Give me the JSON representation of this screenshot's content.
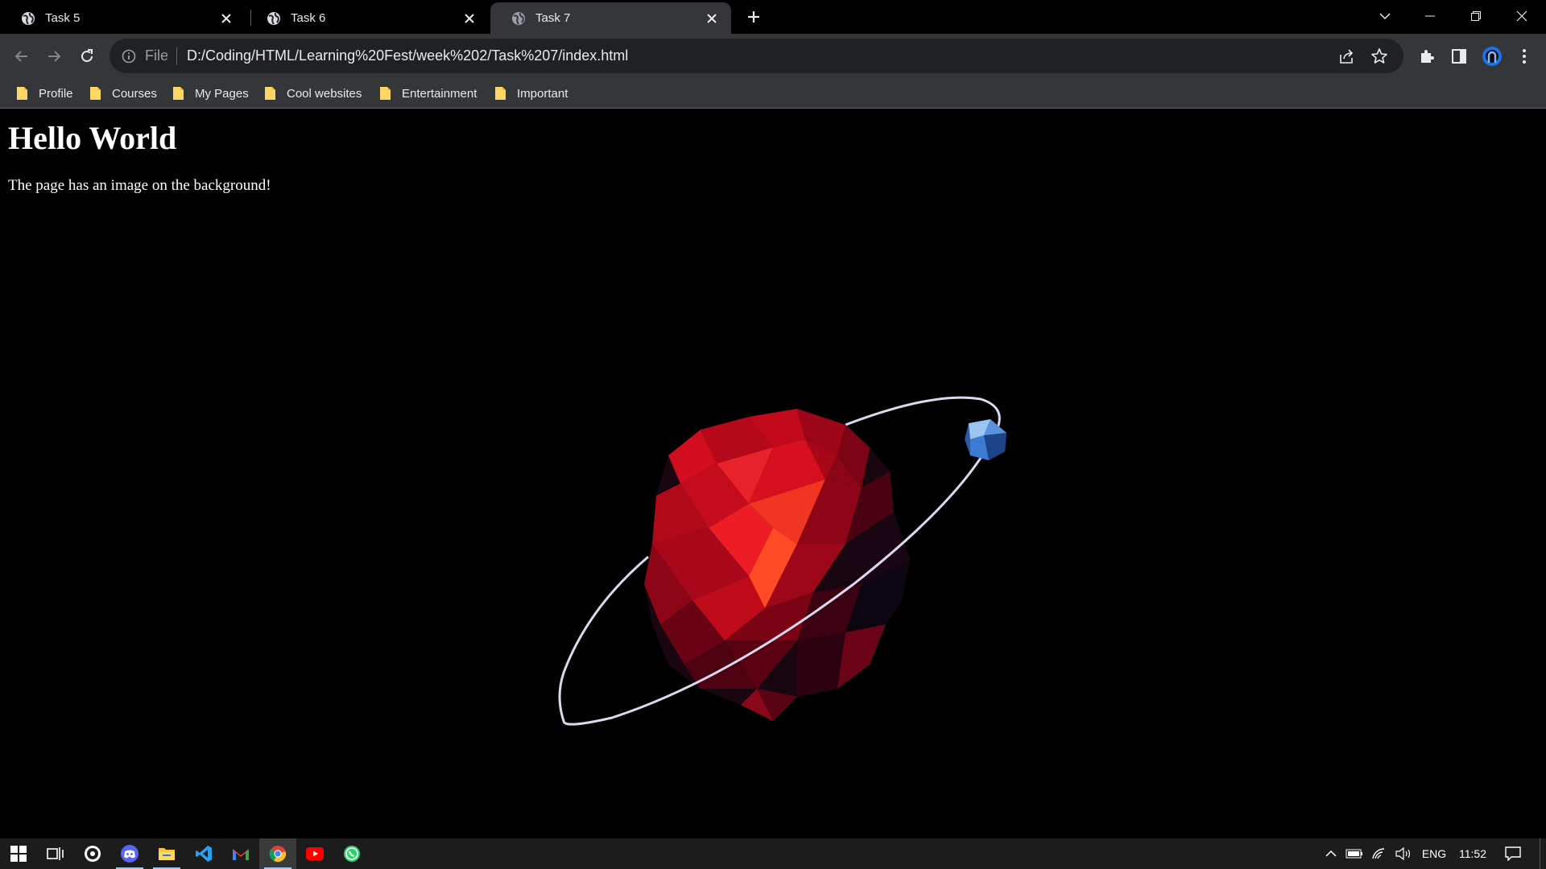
{
  "browser": {
    "tabs": [
      {
        "title": "Task 5",
        "active": false
      },
      {
        "title": "Task 6",
        "active": false
      },
      {
        "title": "Task 7",
        "active": true
      }
    ],
    "address": {
      "scheme_label": "File",
      "url": "D:/Coding/HTML/Learning%20Fest/week%202/Task%207/index.html"
    },
    "bookmarks": [
      "Profile",
      "Courses",
      "My Pages",
      "Cool websites",
      "Entertainment",
      "Important"
    ]
  },
  "page": {
    "heading": "Hello World",
    "paragraph": "The page has an image on the background!",
    "background_color": "#000000"
  },
  "taskbar": {
    "apps": [
      "windows-start",
      "task-view",
      "obs",
      "discord",
      "file-explorer",
      "vscode",
      "gmail",
      "chrome",
      "youtube",
      "whatsapp"
    ],
    "active_app": "chrome",
    "tray": {
      "language": "ENG",
      "time": "11:52"
    }
  },
  "colors": {
    "tab_active_bg": "#35363a",
    "toolbar_bg": "#35363a",
    "omnibox_bg": "#202124",
    "bookmark_folder": "#fdd663",
    "planet_red": "#d7101f",
    "moon_blue": "#3b7bd4",
    "ring": "#d9d9f0"
  }
}
